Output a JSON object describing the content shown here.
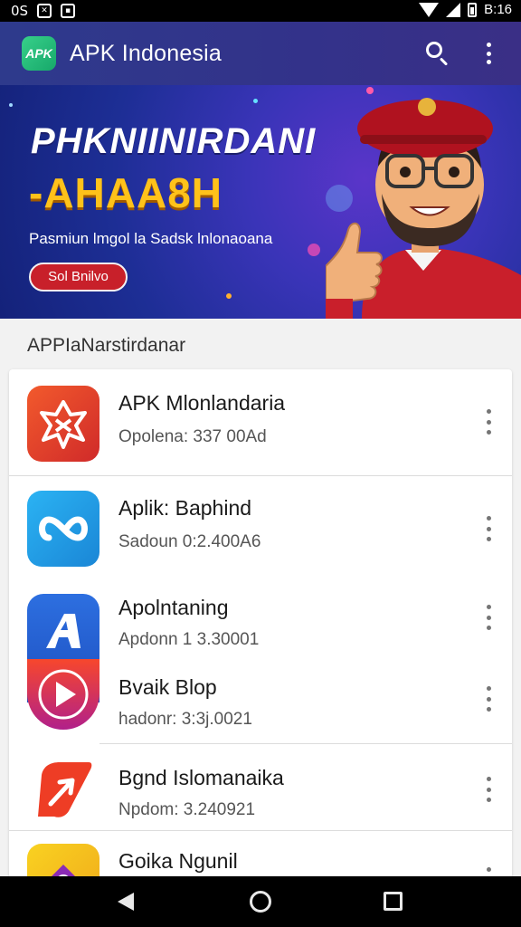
{
  "status_bar": {
    "left_text": "0S",
    "time": "B:16",
    "icons": [
      "alarm-icon",
      "photo-icon",
      "wifi-icon",
      "signal-icon",
      "battery-icon"
    ]
  },
  "app_bar": {
    "logo_text": "APK",
    "title": "APK Indonesia",
    "icons": [
      "search-icon",
      "more-vert-icon"
    ],
    "color": "#2e3a8c"
  },
  "banner": {
    "headline_1": "PHKNIINIRDANI",
    "headline_2": "-AHAA8H",
    "subtitle": "Pasmiun lmgol la Sadsk lnlonaoana",
    "cta_label": "Sol Bnilvo",
    "colors": {
      "headline_2": "#ffc21a",
      "cta": "#c8202a",
      "background": "#1d2e95"
    }
  },
  "section_title": "APPIaNarstirdanar",
  "apps": [
    {
      "title": "APK Mlonlandaria",
      "subtitle": "Opolena: 337 00Ad",
      "icon": "star-knot-icon",
      "color": "#e13b2c"
    },
    {
      "title": "Aplik: Baphind",
      "subtitle": "Sadoun 0:2.400A6",
      "icon": "infinity-icon",
      "color": "#1f9ae6"
    },
    {
      "title": "Apolntaning",
      "subtitle": "Apdonn 1 3.30001",
      "icon": "letter-a-icon",
      "color": "#1e6fd8"
    },
    {
      "title": "Bvaik Blop",
      "subtitle": "hadonr: 3:3j.0021",
      "icon": "play-icon",
      "color": "#f0452c"
    },
    {
      "title": "Bgnd Islomanaika",
      "subtitle": "Npdom: 3.240921",
      "icon": "leaf-icon",
      "color": "#ee3d25"
    },
    {
      "title": "Goika Ngunil",
      "subtitle": "",
      "icon": "gem-icon",
      "color": "#f7c21d"
    }
  ],
  "nav_bar": {
    "icons": [
      "back-icon",
      "home-icon",
      "recents-icon"
    ]
  }
}
